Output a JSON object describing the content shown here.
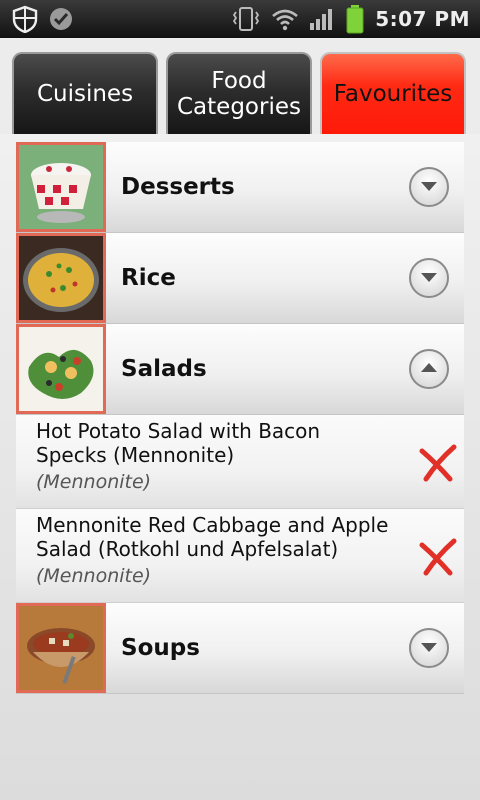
{
  "status_bar": {
    "time": "5:07 PM",
    "icons": [
      "shield-icon",
      "check-icon",
      "vibrate-icon",
      "wifi-icon",
      "signal-icon",
      "battery-icon"
    ]
  },
  "tabs": [
    {
      "label": "Cuisines",
      "active": false
    },
    {
      "label": "Food Categories",
      "active": false
    },
    {
      "label": "Favourites",
      "active": true
    }
  ],
  "groups": [
    {
      "label": "Desserts",
      "expanded": false,
      "items": []
    },
    {
      "label": "Rice",
      "expanded": false,
      "items": []
    },
    {
      "label": "Salads",
      "expanded": true,
      "items": [
        {
          "title": "Hot Potato Salad with Bacon Specks (Mennonite)",
          "subtitle": "(Mennonite)"
        },
        {
          "title": "Mennonite Red Cabbage and Apple Salad (Rotkohl und Apfelsalat)",
          "subtitle": "(Mennonite)"
        }
      ]
    },
    {
      "label": "Soups",
      "expanded": false,
      "items": []
    }
  ],
  "colors": {
    "active_tab": "#ff2a14",
    "thumb_border": "#e06a55",
    "delete_x": "#e03028"
  }
}
